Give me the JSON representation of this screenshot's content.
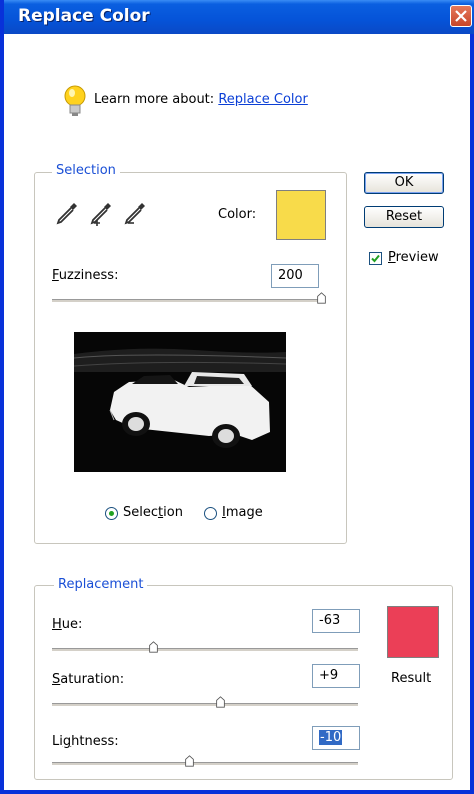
{
  "window": {
    "title": "Replace Color"
  },
  "tip": {
    "prefix": "Learn more about:",
    "link": "Replace Color"
  },
  "selection": {
    "group_label": "Selection",
    "color_label": "Color:",
    "color_value": "#f8db4a",
    "fuzziness_label": "Fuzziness:",
    "fuzziness_value": "200",
    "fuzziness_fraction": 1.0,
    "radio_selection_label": "Selection",
    "radio_image_label": "Image",
    "selected_mode": "Selection"
  },
  "buttons": {
    "ok": "OK",
    "reset": "Reset"
  },
  "preview": {
    "label": "Preview",
    "checked": true
  },
  "replacement": {
    "group_label": "Replacement",
    "hue_label": "Hue:",
    "hue_value": "-63",
    "saturation_label": "Saturation:",
    "saturation_value": "+9",
    "lightness_label": "Lightness:",
    "lightness_value": "-10",
    "result_label": "Result",
    "result_color": "#eb3f57"
  },
  "colors": {
    "accent": "#1a4fd6",
    "title_bar": "#0553d8"
  }
}
